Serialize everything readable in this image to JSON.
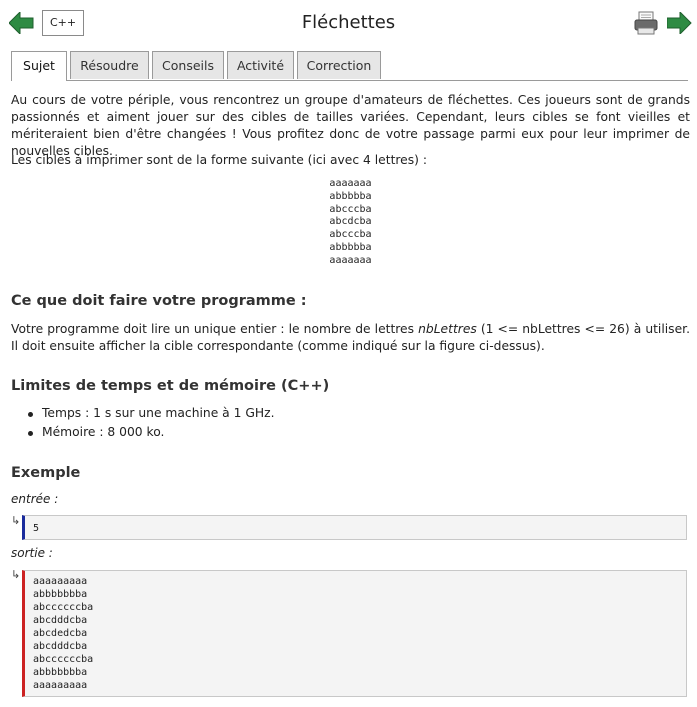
{
  "header": {
    "title": "Fléchettes",
    "language_button": "C++"
  },
  "colors": {
    "nav_arrow": "#2e8b43",
    "input_border": "#1a2b9c",
    "output_border": "#cc2222"
  },
  "icons": {
    "back": "arrow-left-icon",
    "forward": "arrow-right-icon",
    "print": "printer-icon"
  },
  "tabs": [
    {
      "label": "Sujet",
      "active": true
    },
    {
      "label": "Résoudre",
      "active": false
    },
    {
      "label": "Conseils",
      "active": false
    },
    {
      "label": "Activité",
      "active": false
    },
    {
      "label": "Correction",
      "active": false
    }
  ],
  "statement": {
    "intro": "Au cours de votre périple, vous rencontrez un groupe d'amateurs de fléchettes. Ces joueurs sont de grands passionnés et aiment jouer sur des cibles de tailles variées. Cependant, leurs cibles se font vieilles et mériteraient bien d'être changées ! Vous profitez donc de votre passage parmi eux pour leur imprimer de nouvelles cibles.",
    "form_intro": "Les cibles à imprimer sont de la forme suivante (ici avec 4 lettres) :",
    "figure_lines": [
      "aaaaaaa",
      "abbbbba",
      "abcccba",
      "abcdcba",
      "abcccba",
      "abbbbba",
      "aaaaaaa"
    ],
    "program_heading": "Ce que doit faire votre programme :",
    "program_text_1": "Votre programme doit lire un unique entier : le nombre de lettres ",
    "program_text_var": "nbLettres",
    "program_text_2": " (1 <= nbLettres <= 26) à utiliser. Il doit ensuite afficher la cible correspondante (comme indiqué sur la figure ci-dessus).",
    "limits_heading": "Limites de temps et de mémoire (C++)",
    "limits": [
      "Temps : 1 s sur une machine à 1 GHz.",
      "Mémoire : 8 000 ko."
    ],
    "example_heading": "Exemple",
    "input_label": "entrée :",
    "output_label": "sortie :",
    "return_symbol": "↳",
    "input_value": "5",
    "output_lines": [
      "aaaaaaaaa",
      "abbbbbbba",
      "abccccccba",
      "abcdddcba",
      "abcdedcba",
      "abcdddcba",
      "abccccccba",
      "abbbbbbba",
      "aaaaaaaaa"
    ]
  }
}
